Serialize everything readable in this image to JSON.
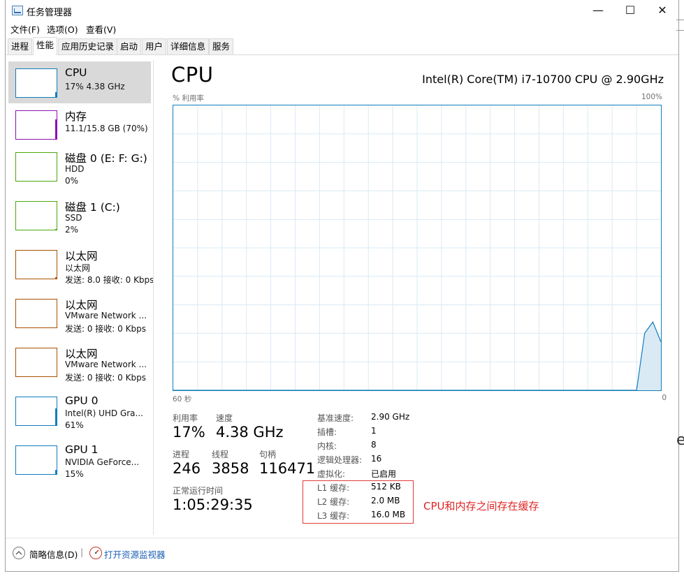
{
  "window": {
    "title": "任务管理器",
    "minimize": "—",
    "maximize": "☐",
    "close": "✕"
  },
  "menu": [
    "文件(F)",
    "选项(O)",
    "查看(V)"
  ],
  "tabs": [
    "进程",
    "性能",
    "应用历史记录",
    "启动",
    "用户",
    "详细信息",
    "服务"
  ],
  "active_tab_index": 1,
  "sidebar": [
    {
      "title": "CPU",
      "sub1": "17%  4.38 GHz",
      "sub2": "",
      "color": "#117dbb",
      "fill": 0.17
    },
    {
      "title": "内存",
      "sub1": "11.1/15.8 GB (70%)",
      "sub2": "",
      "color": "#8b12ae",
      "fill": 0.7
    },
    {
      "title": "磁盘 0 (E: F: G:)",
      "sub1": "HDD",
      "sub2": "0%",
      "color": "#4da60c",
      "fill": 0.0
    },
    {
      "title": "磁盘 1 (C:)",
      "sub1": "SSD",
      "sub2": "2%",
      "color": "#4da60c",
      "fill": 0.02
    },
    {
      "title": "以太网",
      "sub1": "以太网",
      "sub2": "发送: 8.0  接收: 0 Kbps",
      "color": "#a74f01",
      "fill": 0.05
    },
    {
      "title": "以太网",
      "sub1": "VMware Network ...",
      "sub2": "发送: 0  接收: 0 Kbps",
      "color": "#a74f01",
      "fill": 0.0
    },
    {
      "title": "以太网",
      "sub1": "VMware Network ...",
      "sub2": "发送: 0  接收: 0 Kbps",
      "color": "#a74f01",
      "fill": 0.0
    },
    {
      "title": "GPU 0",
      "sub1": "Intel(R) UHD Gra...",
      "sub2": "61%",
      "color": "#117dbb",
      "fill": 0.61
    },
    {
      "title": "GPU 1",
      "sub1": "NVIDIA GeForce...",
      "sub2": "15%",
      "color": "#117dbb",
      "fill": 0.15
    }
  ],
  "main": {
    "title": "CPU",
    "model": "Intel(R) Core(TM) i7-10700 CPU @ 2.90GHz",
    "graph_ylabel": "% 利用率",
    "graph_ymax": "100%",
    "graph_xleft": "60 秒",
    "graph_xright": "0",
    "stats": {
      "util_label": "利用率",
      "util_value": "17%",
      "speed_label": "速度",
      "speed_value": "4.38 GHz",
      "proc_label": "进程",
      "proc_value": "246",
      "thread_label": "线程",
      "thread_value": "3858",
      "handle_label": "句柄",
      "handle_value": "116471",
      "uptime_label": "正常运行时间",
      "uptime_value": "1:05:29:35"
    },
    "info": [
      {
        "label": "基准速度:",
        "value": "2.90 GHz"
      },
      {
        "label": "插槽:",
        "value": "1"
      },
      {
        "label": "内核:",
        "value": "8"
      },
      {
        "label": "逻辑处理器:",
        "value": "16"
      },
      {
        "label": "虚拟化:",
        "value": "已启用"
      },
      {
        "label": "L1 缓存:",
        "value": "512 KB"
      },
      {
        "label": "L2 缓存:",
        "value": "2.0 MB"
      },
      {
        "label": "L3 缓存:",
        "value": "16.0 MB"
      }
    ],
    "annotation": "CPU和内存之间存在缓存"
  },
  "chart_data": {
    "type": "area",
    "title": "",
    "ylabel": "% 利用率",
    "x": [
      60,
      59,
      58,
      57,
      56,
      55,
      54,
      53,
      52,
      51,
      50,
      49,
      48,
      47,
      46,
      45,
      44,
      43,
      42,
      41,
      40,
      39,
      38,
      37,
      36,
      35,
      34,
      33,
      32,
      31,
      30,
      29,
      28,
      27,
      26,
      25,
      24,
      23,
      22,
      21,
      20,
      19,
      18,
      17,
      16,
      15,
      14,
      13,
      12,
      11,
      10,
      9,
      8,
      7,
      6,
      5,
      4,
      3,
      2,
      1,
      0
    ],
    "values": [
      0,
      0,
      0,
      0,
      0,
      0,
      0,
      0,
      0,
      0,
      0,
      0,
      0,
      0,
      0,
      0,
      0,
      0,
      0,
      0,
      0,
      0,
      0,
      0,
      0,
      0,
      0,
      0,
      0,
      0,
      0,
      0,
      0,
      0,
      0,
      0,
      0,
      0,
      0,
      0,
      0,
      0,
      0,
      0,
      0,
      0,
      0,
      0,
      0,
      0,
      0,
      0,
      0,
      0,
      0,
      0,
      0,
      0,
      20,
      24,
      17
    ],
    "ylim": [
      0,
      100
    ],
    "xlim": [
      60,
      0
    ],
    "grid": true,
    "color": "#117dbb"
  },
  "footer": {
    "summary": "简略信息(D)",
    "separator": "|",
    "monitor": "打开资源监视器"
  },
  "edge_letter": "e"
}
